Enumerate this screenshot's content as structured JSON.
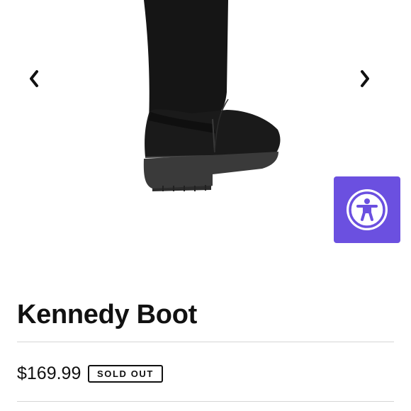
{
  "theme": {
    "accessibility_bg": "#6B50E0",
    "text_color": "#111111"
  },
  "carousel": {
    "prev_icon": "chevron-left-icon",
    "next_icon": "chevron-right-icon"
  },
  "accessibility": {
    "icon": "accessibility-icon"
  },
  "product": {
    "title": "Kennedy Boot",
    "price": "$169.99",
    "status_badge": "SOLD OUT"
  }
}
